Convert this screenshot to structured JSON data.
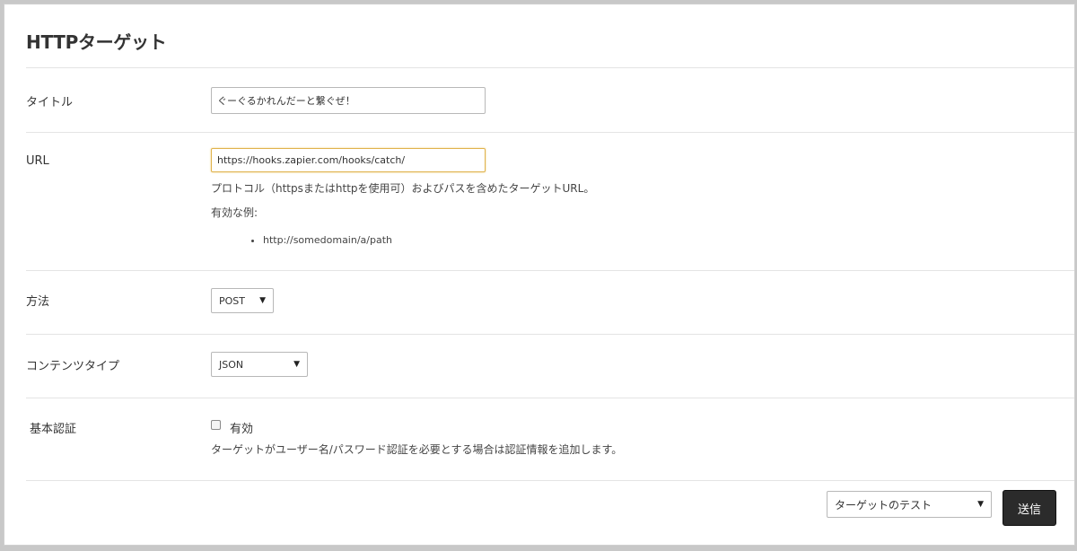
{
  "header": {
    "title": "HTTPターゲット"
  },
  "form": {
    "title_field": {
      "label": "タイトル",
      "value": "ぐーぐるかれんだーと繋ぐぜ！"
    },
    "url_field": {
      "label": "URL",
      "value": "https://hooks.zapier.com/hooks/catch/",
      "help": "プロトコル（httpsまたはhttpを使用可）およびパスを含めたターゲットURL。",
      "example_heading": "有効な例:",
      "examples": [
        "http://somedomain/a/path"
      ]
    },
    "method_field": {
      "label": "方法",
      "selected": "POST"
    },
    "content_type_field": {
      "label": "コンテンツタイプ",
      "selected": "JSON"
    },
    "basic_auth_field": {
      "label": "基本認証",
      "checkbox_label": "有効",
      "checked": false,
      "help": "ターゲットがユーザー名/パスワード認証を必要とする場合は認証情報を追加します。"
    }
  },
  "footer": {
    "test_select": "ターゲットのテスト",
    "submit_label": "送信"
  }
}
